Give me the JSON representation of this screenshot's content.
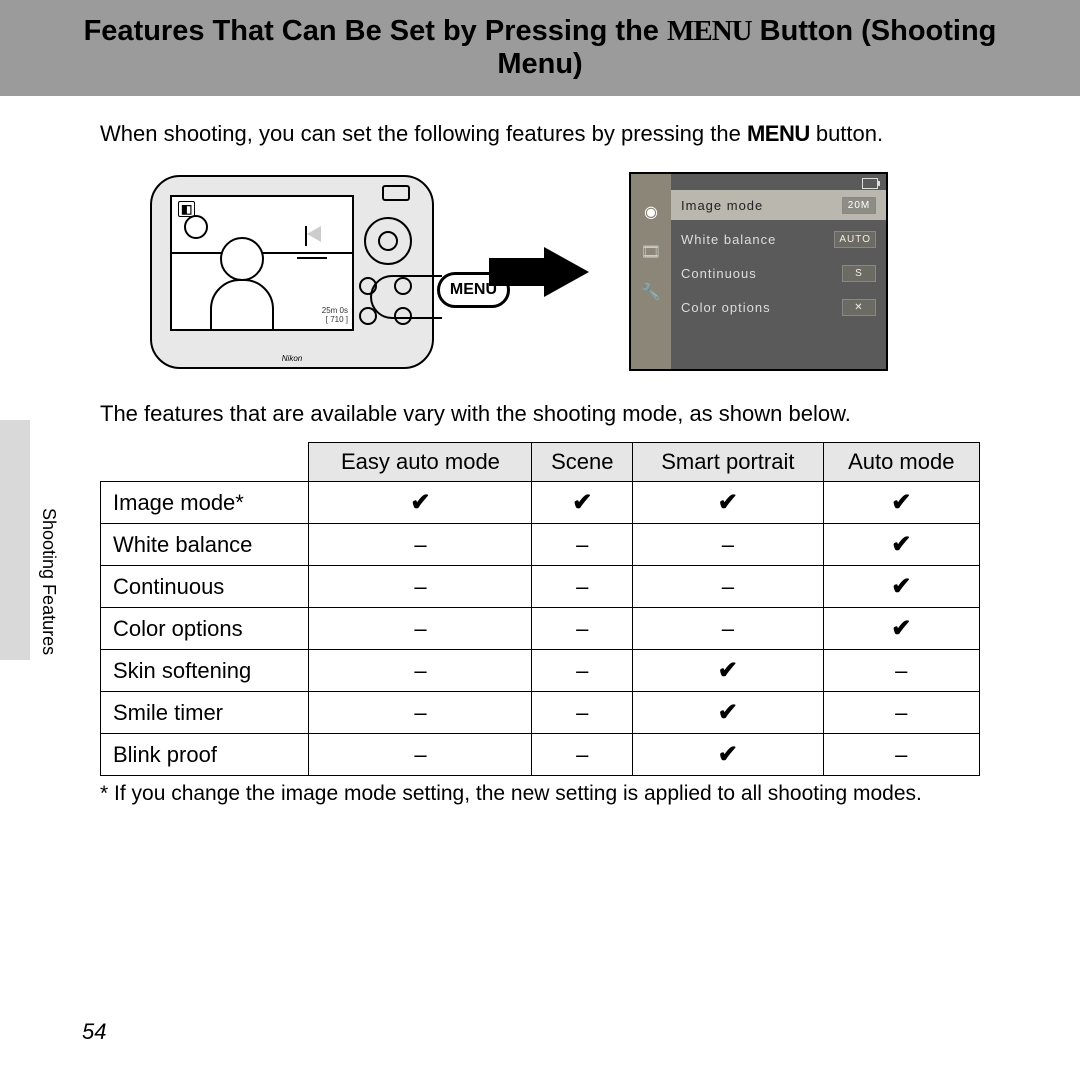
{
  "title": {
    "prefix": "Features That Can Be Set by Pressing the ",
    "menu_word": "MENU",
    "suffix": " Button (Shooting Menu)"
  },
  "intro": {
    "prefix": "When shooting, you can set the following features by pressing the ",
    "menu_word": "MENU",
    "suffix": " button."
  },
  "camera": {
    "menu_label": "MENU",
    "brand": "Nikon"
  },
  "menu_screen": {
    "items": [
      {
        "label": "Image mode",
        "badge": "20M",
        "selected": true
      },
      {
        "label": "White balance",
        "badge": "AUTO",
        "selected": false
      },
      {
        "label": "Continuous",
        "badge": "S",
        "selected": false
      },
      {
        "label": "Color options",
        "badge": "✕",
        "selected": false
      }
    ]
  },
  "desc2": "The features that are available vary with the shooting mode, as shown below.",
  "feature_table": {
    "columns": [
      "Easy auto mode",
      "Scene",
      "Smart portrait",
      "Auto mode"
    ],
    "rows": [
      {
        "label": "Image mode*",
        "cells": [
          "check",
          "check",
          "check",
          "check"
        ]
      },
      {
        "label": "White balance",
        "cells": [
          "dash",
          "dash",
          "dash",
          "check"
        ]
      },
      {
        "label": "Continuous",
        "cells": [
          "dash",
          "dash",
          "dash",
          "check"
        ]
      },
      {
        "label": "Color options",
        "cells": [
          "dash",
          "dash",
          "dash",
          "check"
        ]
      },
      {
        "label": "Skin softening",
        "cells": [
          "dash",
          "dash",
          "check",
          "dash"
        ]
      },
      {
        "label": "Smile timer",
        "cells": [
          "dash",
          "dash",
          "check",
          "dash"
        ]
      },
      {
        "label": "Blink proof",
        "cells": [
          "dash",
          "dash",
          "check",
          "dash"
        ]
      }
    ]
  },
  "footnote": "*   If you change the image mode setting, the new setting is applied to all shooting modes.",
  "side_label": "Shooting Features",
  "page_number": "54",
  "glyphs": {
    "check": "✔",
    "dash": "–"
  }
}
